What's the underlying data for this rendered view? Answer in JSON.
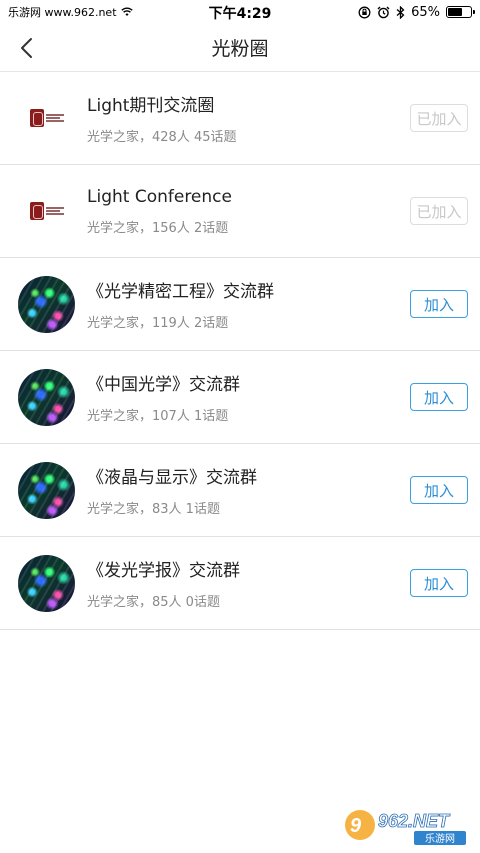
{
  "status_bar": {
    "carrier": "乐游网 www.962.net",
    "time": "下午4:29",
    "battery": "65%",
    "battery_level": 0.65
  },
  "nav": {
    "title": "光粉圈",
    "back_icon": "chevron-left-icon"
  },
  "groups": [
    {
      "name": "Light期刊交流圈",
      "meta": "光学之家，428人 45话题",
      "button": "已加入",
      "joined": true,
      "avatar": "logo"
    },
    {
      "name": "Light Conference",
      "meta": "光学之家，156人 2话题",
      "button": "已加入",
      "joined": true,
      "avatar": "logo"
    },
    {
      "name": "《光学精密工程》交流群",
      "meta": "光学之家，119人 2话题",
      "button": "加入",
      "joined": false,
      "avatar": "fiber"
    },
    {
      "name": "《中国光学》交流群",
      "meta": "光学之家，107人 1话题",
      "button": "加入",
      "joined": false,
      "avatar": "fiber"
    },
    {
      "name": "《液晶与显示》交流群",
      "meta": "光学之家，83人 1话题",
      "button": "加入",
      "joined": false,
      "avatar": "fiber"
    },
    {
      "name": "《发光学报》交流群",
      "meta": "光学之家，85人 0话题",
      "button": "加入",
      "joined": false,
      "avatar": "fiber"
    }
  ],
  "watermark": {
    "brand": "962.NET",
    "sub": "乐游网"
  },
  "colors": {
    "accent": "#2c8fd6",
    "disabled": "#c8c8c8"
  }
}
